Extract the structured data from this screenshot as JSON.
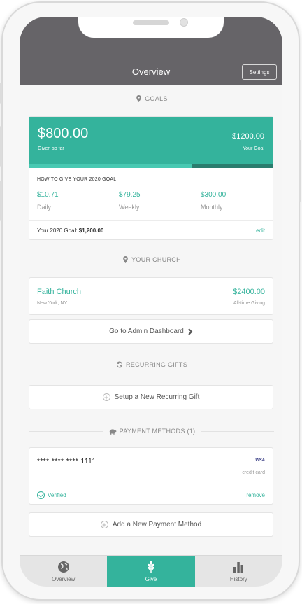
{
  "header": {
    "title": "Overview",
    "settings_label": "Settings"
  },
  "goals": {
    "section_label": "GOALS",
    "given_amount": "$800.00",
    "given_label": "Given so far",
    "goal_amount": "$1200.00",
    "goal_label": "Your Goal",
    "progress_fraction": 0.667,
    "how_title": "HOW TO GIVE YOUR 2020 GOAL",
    "rates": [
      {
        "value": "$10.71",
        "label": "Daily"
      },
      {
        "value": "$79.25",
        "label": "Weekly"
      },
      {
        "value": "$300.00",
        "label": "Monthly"
      }
    ],
    "footer_prefix": "Your 2020 Goal: ",
    "footer_amount": "$1,200.00",
    "edit_label": "edit"
  },
  "church": {
    "section_label": "YOUR CHURCH",
    "name": "Faith Church",
    "location": "New York, NY",
    "amount": "$2400.00",
    "amount_label": "All-time Giving",
    "admin_label": "Go to Admin Dashboard"
  },
  "recurring": {
    "section_label": "RECURRING GIFTS",
    "setup_label": "Setup a New Recurring Gift"
  },
  "payment": {
    "section_label": "PAYMENT METHODS (1)",
    "card_number": "**** **** **** 1111",
    "brand": "VISA",
    "card_type": "credit card",
    "verified_label": "Verified",
    "remove_label": "remove",
    "add_label": "Add a New Payment Method"
  },
  "tabs": [
    {
      "label": "Overview",
      "icon": "globe-icon",
      "active": false
    },
    {
      "label": "Give",
      "icon": "wheat-icon",
      "active": true
    },
    {
      "label": "History",
      "icon": "bar-chart-icon",
      "active": false
    }
  ],
  "colors": {
    "accent": "#34b39c",
    "header_bg": "#666468",
    "progress_track": "#2a7d6e"
  }
}
